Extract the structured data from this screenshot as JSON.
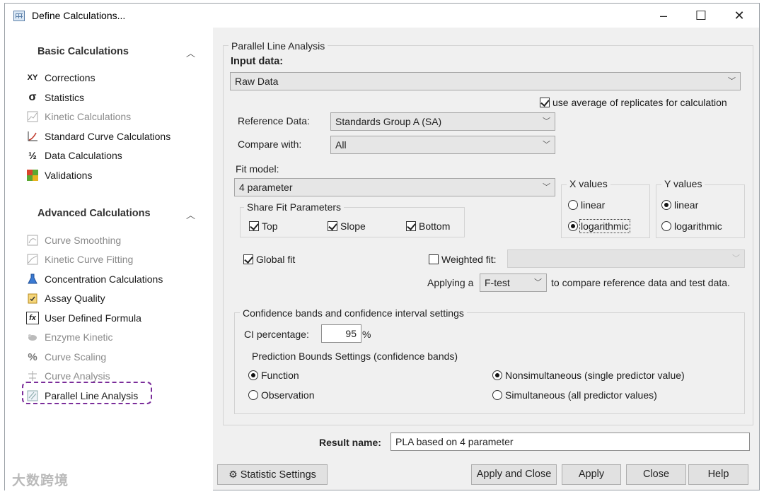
{
  "window": {
    "title": "Define Calculations..."
  },
  "sidebar": {
    "basic_header": "Basic Calculations",
    "basic_items": [
      {
        "label": "Corrections",
        "icon": "xy-icon"
      },
      {
        "label": "Statistics",
        "icon": "sigma-icon"
      },
      {
        "label": "Kinetic Calculations",
        "icon": "kinetic-chart-icon"
      },
      {
        "label": "Standard Curve Calculations",
        "icon": "standard-curve-icon"
      },
      {
        "label": "Data Calculations",
        "icon": "fraction-icon"
      },
      {
        "label": "Validations",
        "icon": "validation-grid-icon"
      }
    ],
    "advanced_header": "Advanced Calculations",
    "advanced_items": [
      {
        "label": "Curve Smoothing",
        "icon": "curve-smoothing-icon"
      },
      {
        "label": "Kinetic Curve Fitting",
        "icon": "kinetic-fit-icon"
      },
      {
        "label": "Concentration Calculations",
        "icon": "flask-icon"
      },
      {
        "label": "Assay Quality",
        "icon": "clipboard-icon"
      },
      {
        "label": "User Defined Formula",
        "icon": "fx-icon"
      },
      {
        "label": "Enzyme Kinetic",
        "icon": "enzyme-icon"
      },
      {
        "label": "Curve Scaling",
        "icon": "percent-icon"
      },
      {
        "label": "Curve Analysis",
        "icon": "curve-analysis-icon"
      },
      {
        "label": "Parallel Line Analysis",
        "icon": "parallel-line-icon"
      }
    ],
    "watermark": "大数跨境"
  },
  "panel": {
    "group_title": "Parallel Line Analysis",
    "input_label": "Input data:",
    "input_value": "Raw Data",
    "use_average_label": "use average of replicates for calculation",
    "use_average_checked": true,
    "reference_label": "Reference Data:",
    "reference_value": "Standards Group A (SA)",
    "compare_label": "Compare with:",
    "compare_value": "All",
    "fit_model_label": "Fit model:",
    "fit_model_value": "4 parameter",
    "x_values": {
      "title": "X values",
      "linear": "linear",
      "logarithmic": "logarithmic",
      "selected": "logarithmic"
    },
    "y_values": {
      "title": "Y values",
      "linear": "linear",
      "logarithmic": "logarithmic",
      "selected": "linear"
    },
    "share": {
      "title": "Share Fit Parameters",
      "top": "Top",
      "slope": "Slope",
      "bottom": "Bottom"
    },
    "global_fit_label": "Global fit",
    "weighted_fit_label": "Weighted fit:",
    "applying_label": "Applying a",
    "test_value": "F-test",
    "applying_suffix": "to compare reference data and test data.",
    "confidence": {
      "title": "Confidence bands and confidence interval settings",
      "ci_label": "CI percentage:",
      "ci_value": "95",
      "ci_unit": "%",
      "prediction_title": "Prediction Bounds Settings (confidence bands)",
      "function": "Function",
      "observation": "Observation",
      "nonsimultaneous": "Nonsimultaneous (single predictor value)",
      "simultaneous": "Simultaneous (all predictor values)"
    },
    "result_label": "Result name:",
    "result_value": "PLA based on 4 parameter"
  },
  "buttons": {
    "statistic_settings": "Statistic Settings",
    "apply_close": "Apply and Close",
    "apply": "Apply",
    "close": "Close",
    "help": "Help"
  }
}
